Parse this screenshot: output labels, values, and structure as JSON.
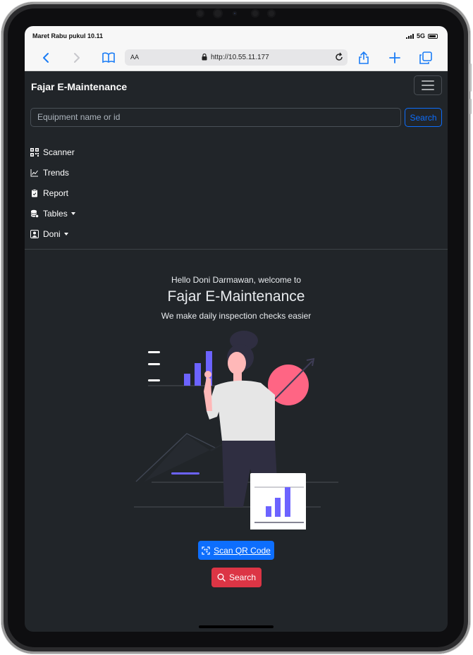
{
  "status_bar": {
    "time": "Maret Rabu pukul 10.11",
    "network": "5G"
  },
  "browser": {
    "text_size_label": "AA",
    "url": "http://10.55.11.177",
    "icons": [
      "back-icon",
      "forward-icon",
      "bookmarks-icon",
      "lock-icon",
      "reload-icon",
      "share-icon",
      "new-tab-icon",
      "tabs-icon"
    ]
  },
  "navbar": {
    "brand": "Fajar E-Maintenance",
    "search_placeholder": "Equipment name or id",
    "search_button": "Search"
  },
  "menu": {
    "items": [
      {
        "label": "Scanner",
        "icon": "qr-code-icon"
      },
      {
        "label": "Trends",
        "icon": "chart-line-icon"
      },
      {
        "label": "Report",
        "icon": "clipboard-icon"
      },
      {
        "label": "Tables",
        "icon": "database-icon",
        "dropdown": true
      },
      {
        "label": "Doni",
        "icon": "user-icon",
        "dropdown": true
      }
    ]
  },
  "hero": {
    "greeting": "Hello Doni Darmawan, welcome to",
    "title": "Fajar E-Maintenance",
    "subtitle": "We make daily inspection checks easier"
  },
  "actions": {
    "scan_label": "Scan QR Code",
    "search_label": "Search"
  },
  "colors": {
    "background": "#212529",
    "primary": "#0d6efd",
    "danger": "#dc3545",
    "accent_purple": "#6c63ff",
    "accent_pink": "#ff6584"
  }
}
